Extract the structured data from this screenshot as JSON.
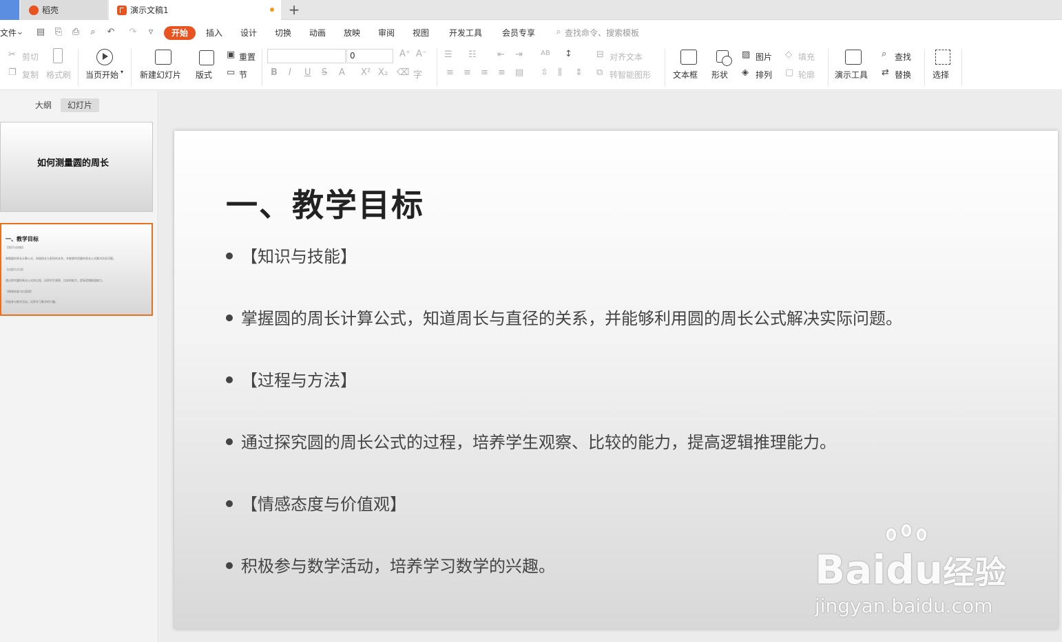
{
  "tabs": {
    "home_label": "",
    "daoke_label": "稻壳",
    "doc_label": "演示文稿1",
    "new_tab": "+"
  },
  "menu": {
    "file": "文件",
    "items": [
      "开始",
      "插入",
      "设计",
      "切换",
      "动画",
      "放映",
      "审阅",
      "视图",
      "开发工具",
      "会员专享"
    ],
    "search_placeholder": "查找命令、搜索模板"
  },
  "ribbon": {
    "cut": "剪切",
    "copy": "复制",
    "format_painter": "格式刷",
    "play_from_current": "当页开始",
    "new_slide": "新建幻灯片",
    "layout": "版式",
    "reset": "重置",
    "section": "节",
    "font_size_value": "0",
    "align_text": "对齐文本",
    "smart_shape": "转智能图形",
    "text_box": "文本框",
    "shape": "形状",
    "picture": "图片",
    "arrange": "排列",
    "fill": "填充",
    "outline": "轮廓",
    "presentation_tools": "演示工具",
    "find": "查找",
    "replace": "替换",
    "select": "选择"
  },
  "left_panel": {
    "tab_outline": "大纲",
    "tab_slides": "幻灯片",
    "slide1_title": "如何测量圆的周长",
    "slide2_title": "一、教学目标",
    "slide2_lines": [
      "【知识与技能】",
      "掌握圆的周长计算公式，知道周长与直径的关系，并能够利用圆的周长公式解决实际问题。",
      "【过程与方法】",
      "通过探究圆的周长公式的过程，培养学生观察、比较的能力，提高逻辑推理能力。",
      "【情感态度与价值观】",
      "积极参与数学活动，培养学习数学的兴趣。"
    ]
  },
  "slide": {
    "title": "一、教学目标",
    "bullets": [
      "【知识与技能】",
      "掌握圆的周长计算公式，知道周长与直径的关系，并能够利用圆的周长公式解决实际问题。",
      "【过程与方法】",
      "通过探究圆的周长公式的过程，培养学生观察、比较的能力，提高逻辑推理能力。",
      "【情感态度与价值观】",
      "积极参与数学活动，培养学习数学的兴趣。"
    ]
  },
  "watermark": {
    "brand": "Bai",
    "brand2": "du",
    "cn": "经验",
    "url": "jingyan.baidu.com"
  },
  "colors": {
    "accent": "#e8531f",
    "selected_thumb_border": "#e8701f",
    "home_tab": "#5b8de0"
  }
}
